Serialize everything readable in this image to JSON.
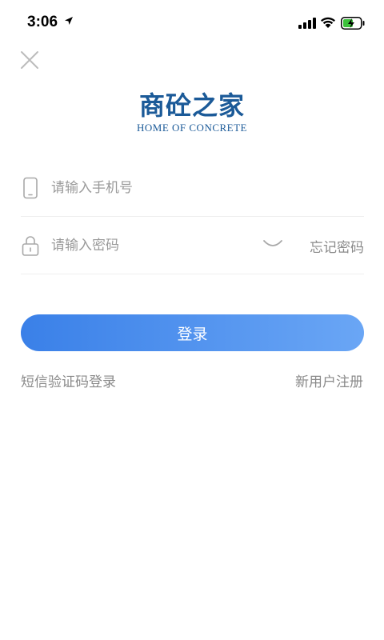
{
  "status_bar": {
    "time": "3:06",
    "icons": [
      "location-arrow-icon",
      "signal-icon",
      "wifi-icon",
      "battery-charging-icon"
    ]
  },
  "header": {
    "close_icon": "close-icon"
  },
  "logo": {
    "title_cn": "商砼之家",
    "title_en": "HOME  OF CONCRETE"
  },
  "form": {
    "phone": {
      "icon": "phone-icon",
      "value": "",
      "placeholder": "请输入手机号"
    },
    "password": {
      "icon": "lock-icon",
      "value": "",
      "placeholder": "请输入密码",
      "toggle_icon": "eye-closed-icon",
      "forgot_label": "忘记密码"
    },
    "login_label": "登录"
  },
  "footer_links": {
    "sms_login": "短信验证码登录",
    "register": "新用户注册"
  },
  "colors": {
    "brand": "#1b5a98",
    "button_gradient_start": "#3a80e8",
    "button_gradient_end": "#6aa6f5",
    "muted_text": "#8a8a8a"
  }
}
